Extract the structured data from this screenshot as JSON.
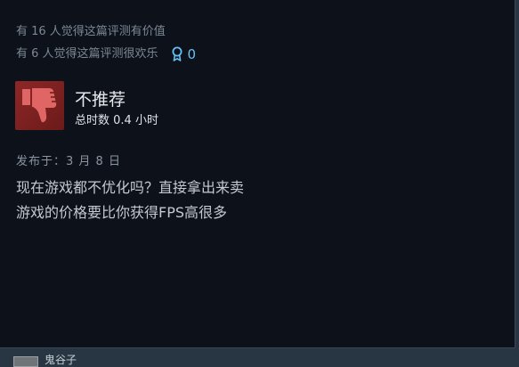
{
  "review": {
    "helpful_text": "有 16 人觉得这篇评测有价值",
    "funny_text": "有 6 人觉得这篇评测很欢乐",
    "award_icon": "award-ribbon-icon",
    "award_count": "0",
    "verdict": "不推荐",
    "verdict_icon": "thumbs-down-icon",
    "hours_text": "总时数 0.4 小时",
    "posted_text": "发布于：3 月 8 日",
    "body_lines": [
      "现在游戏都不优化吗？直接拿出来卖",
      "游戏的价格要比你获得FPS高很多"
    ]
  },
  "next_review": {
    "author_name": "鬼谷子"
  },
  "colors": {
    "card_bg": "#0d121a",
    "page_bg": "#283542",
    "accent_blue": "#66c0f4",
    "thumb_bg": "#8e2727",
    "thumb_icon": "#e06565"
  }
}
